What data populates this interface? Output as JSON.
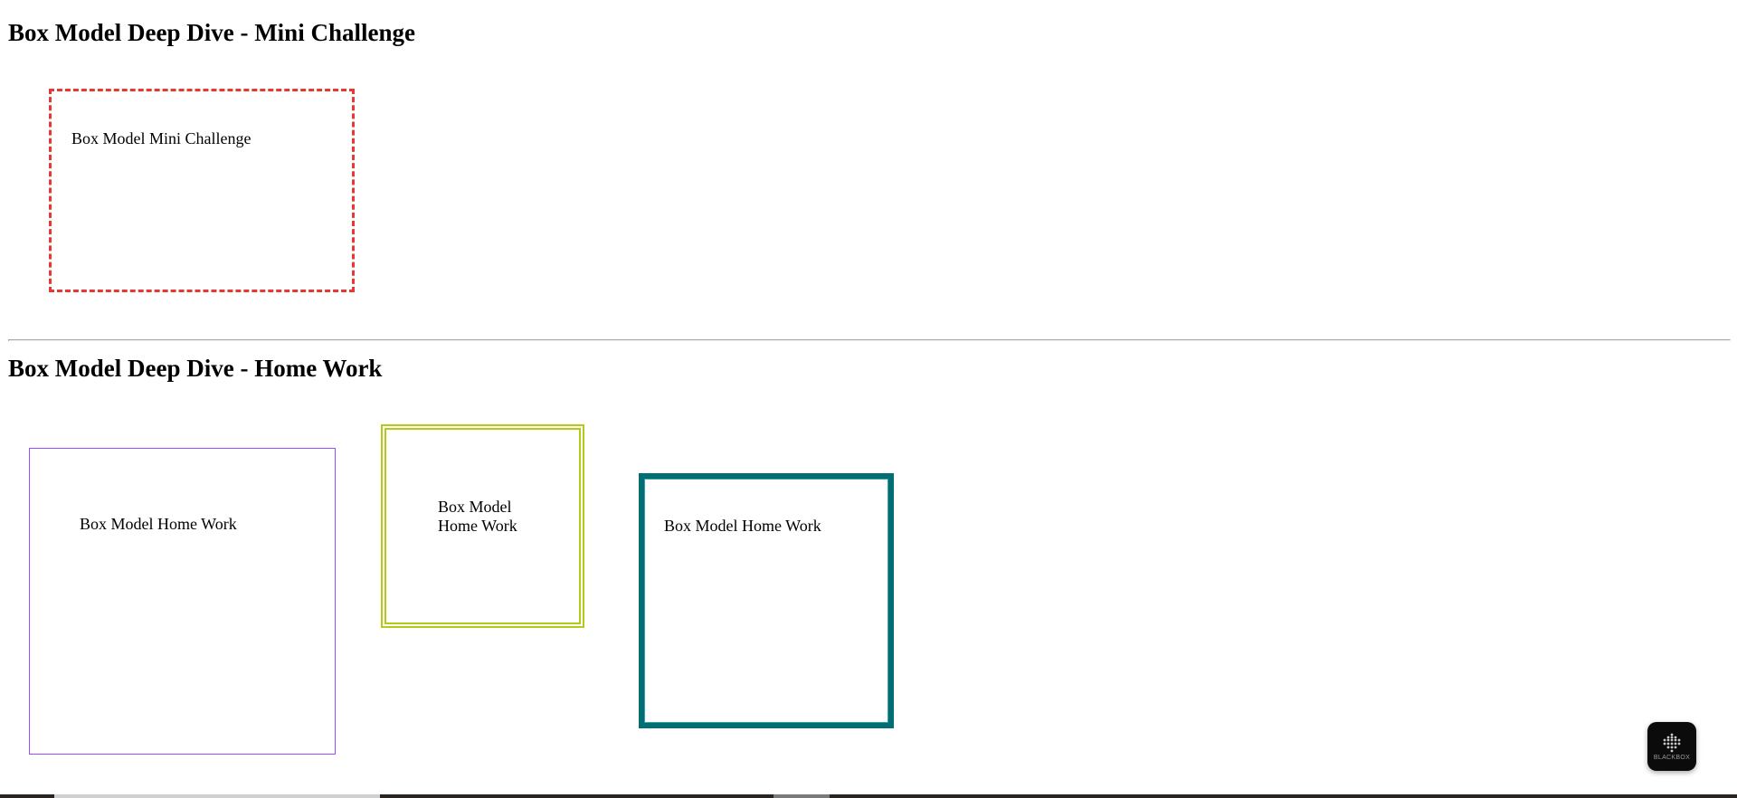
{
  "sections": {
    "mini": {
      "heading": "Box Model Deep Dive - Mini Challenge",
      "box_text": "Box Model Mini Challenge",
      "border_color": "#e53935"
    },
    "homework": {
      "heading": "Box Model Deep Dive - Home Work",
      "boxes": [
        {
          "text": "Box Model Home Work",
          "border_color": "#9b4dff"
        },
        {
          "text": "Box Model Home Work",
          "border_color": "#b5c916"
        },
        {
          "text": "Box Model Home Work",
          "border_color": "#006e72"
        }
      ]
    }
  },
  "fab": {
    "icon": "blackbox-logo-icon",
    "label": "BLACKBOX"
  }
}
